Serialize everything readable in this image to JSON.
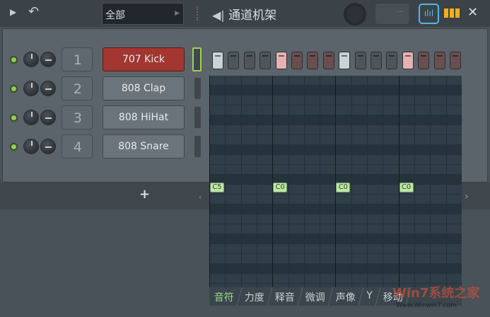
{
  "toolbar": {
    "preset": "全部",
    "title": "通道机架"
  },
  "channels": [
    {
      "num": "1",
      "name": "707 Kick",
      "selected": true
    },
    {
      "num": "2",
      "name": "808 Clap",
      "selected": false
    },
    {
      "num": "3",
      "name": "808 HiHat",
      "selected": false
    },
    {
      "num": "4",
      "name": "808 Snare",
      "selected": false
    }
  ],
  "steps": [
    "w",
    "g",
    "g",
    "g",
    "p",
    "b",
    "b",
    "b",
    "w",
    "g",
    "g",
    "g",
    "p",
    "b",
    "b",
    "b"
  ],
  "add_label": "+",
  "notes": [
    {
      "label": "C5"
    },
    {
      "label": "C0"
    },
    {
      "label": "C0"
    },
    {
      "label": "C0"
    }
  ],
  "tabs": [
    "音符",
    "力度",
    "释音",
    "微调",
    "声像",
    "Y",
    "移动"
  ],
  "watermark": {
    "brand": "Win7系统之家",
    "url": "Www.Winwin7.com"
  },
  "colors": {
    "accent": "#9fd14a",
    "selected_channel": "#a33631",
    "graph_icon": "#4fb8e8"
  }
}
